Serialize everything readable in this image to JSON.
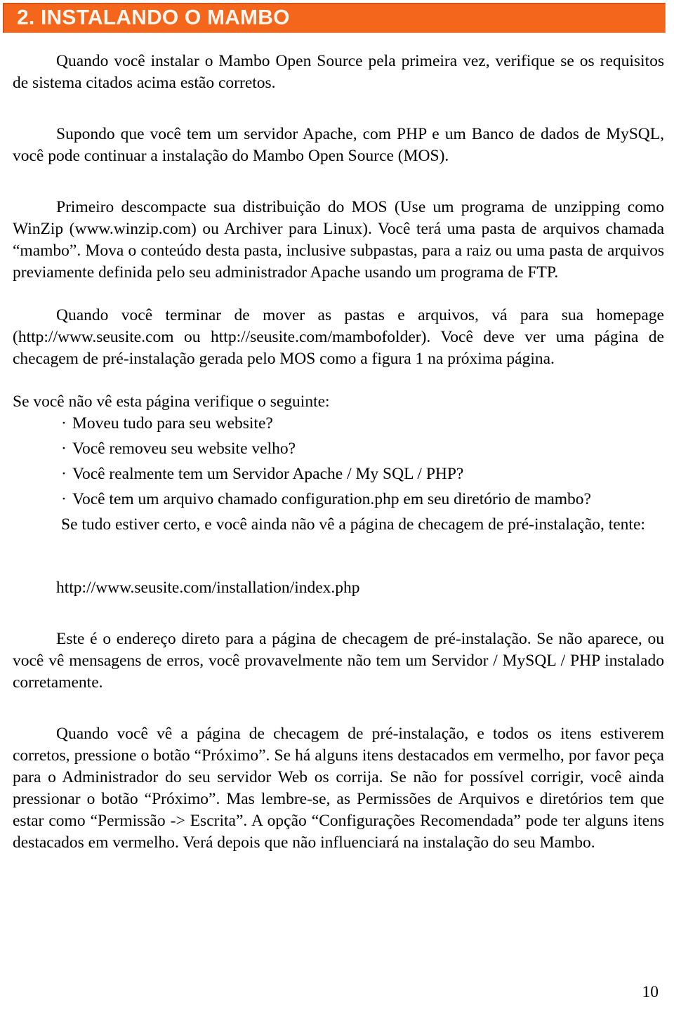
{
  "document": {
    "heading": "2. INSTALANDO O MAMBO",
    "heading_bar_color": "#F4661B",
    "heading_text_color": "#FDF6EF",
    "page_number": "10"
  },
  "paragraphs": {
    "p1": "Quando você instalar o Mambo Open Source pela primeira vez, verifique se os requisitos de sistema citados acima estão corretos.",
    "p2": "Supondo que você tem um servidor Apache, com PHP e um Banco de dados de MySQL, você pode continuar a instalação do Mambo Open Source (MOS).",
    "p3": "Primeiro descompacte sua distribuição do MOS (Use um programa de unzipping como WinZip (www.winzip.com) ou Archiver para Linux). Você terá uma pasta de arquivos chamada “mambo”. Mova o conteúdo desta pasta, inclusive subpastas, para a raiz ou uma pasta de arquivos previamente definida pelo seu administrador Apache usando um programa de FTP.",
    "p4": "Quando você terminar de mover as pastas e arquivos, vá para sua homepage (http://www.seusite.com ou http://seusite.com/mambofolder). Você deve ver uma página de checagem de pré-instalação gerada pelo MOS como a figura 1 na próxima página.",
    "p5": "Se você não vê esta página verifique o seguinte:",
    "p6": "Este é o endereço direto para a página de checagem de pré-instalação. Se não aparece, ou você vê mensagens de erros, você provavelmente não tem um Servidor / MySQL / PHP instalado corretamente.",
    "p7": "Quando você vê a página de checagem de pré-instalação, e todos os itens estiverem corretos, pressione o botão “Próximo”. Se há alguns itens destacados em vermelho, por favor peça  para o Administrador do seu servidor Web os corrija. Se não for possível corrigir, você ainda pressionar o botão “Próximo”. Mas lembre-se, as Permissões de Arquivos e diretórios tem que estar como “Permissão -> Escrita”.  A opção “Configurações Recomendada” pode ter alguns itens destacados em vermelho. Verá depois que não influenciará na instalação do seu Mambo."
  },
  "checklist": {
    "bullet_glyph": "·",
    "items": [
      "Moveu tudo para seu website?",
      "Você removeu seu website velho?",
      "Você realmente tem um Servidor Apache / My SQL / PHP?",
      "Você tem um arquivo chamado configuration.php em seu diretório de mambo?",
      "Se tudo estiver certo, e você ainda não vê a página de checagem de pré-instalação, tente:"
    ]
  },
  "links": {
    "installation_url": "http://www.seusite.com/installation/index.php"
  }
}
